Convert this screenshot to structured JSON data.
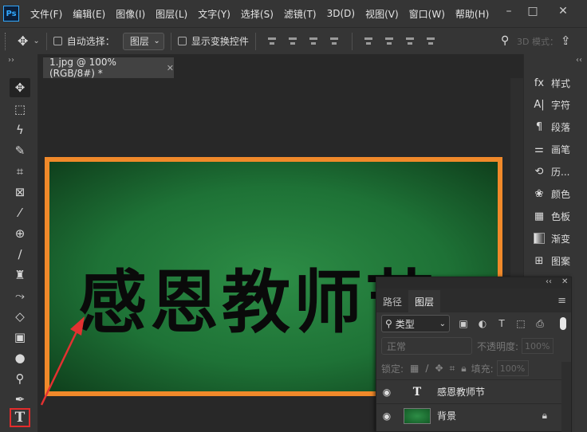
{
  "app": {
    "logo": "Ps"
  },
  "menu": [
    "文件(F)",
    "编辑(E)",
    "图像(I)",
    "图层(L)",
    "文字(Y)",
    "选择(S)",
    "滤镜(T)",
    "3D(D)",
    "视图(V)",
    "窗口(W)",
    "帮助(H)"
  ],
  "window_controls": {
    "minimize": "–",
    "maximize": "□",
    "close": "✕"
  },
  "options": {
    "auto_select_label": "自动选择：",
    "auto_select_target": "图层",
    "show_transform_label": "显示变换控件",
    "mode_3d": "3D 模式："
  },
  "document": {
    "tab_title": "1.jpg @ 100%(RGB/8#) *",
    "close": "✕"
  },
  "canvas": {
    "text": "感恩教师节"
  },
  "dock": [
    {
      "icon": "fx-icon",
      "glyph": "fx",
      "label": "样式"
    },
    {
      "icon": "character-icon",
      "glyph": "A|",
      "label": "字符"
    },
    {
      "icon": "paragraph-icon",
      "glyph": "¶",
      "label": "段落"
    },
    {
      "icon": "brush-settings-icon",
      "glyph": "⚌",
      "label": "画笔"
    },
    {
      "icon": "history-icon",
      "glyph": "⟲",
      "label": "历..."
    },
    {
      "icon": "color-icon",
      "glyph": "❀",
      "label": "颜色"
    },
    {
      "icon": "swatches-icon",
      "glyph": "▦",
      "label": "色板"
    },
    {
      "icon": "gradient-icon",
      "glyph": "",
      "label": "渐变"
    },
    {
      "icon": "pattern-icon",
      "glyph": "⊞",
      "label": "图案"
    }
  ],
  "layers_panel": {
    "tabs": [
      "路径",
      "图层"
    ],
    "active_tab": "图层",
    "filter": "类型",
    "blend_mode": "正常",
    "opacity_label": "不透明度:",
    "opacity_value": "100%",
    "lock_label": "锁定:",
    "fill_label": "填充:",
    "fill_value": "100%",
    "layers": [
      {
        "name": "感恩教师节",
        "type": "text",
        "thumb": "T"
      },
      {
        "name": "背景",
        "type": "image",
        "locked": true
      }
    ]
  }
}
